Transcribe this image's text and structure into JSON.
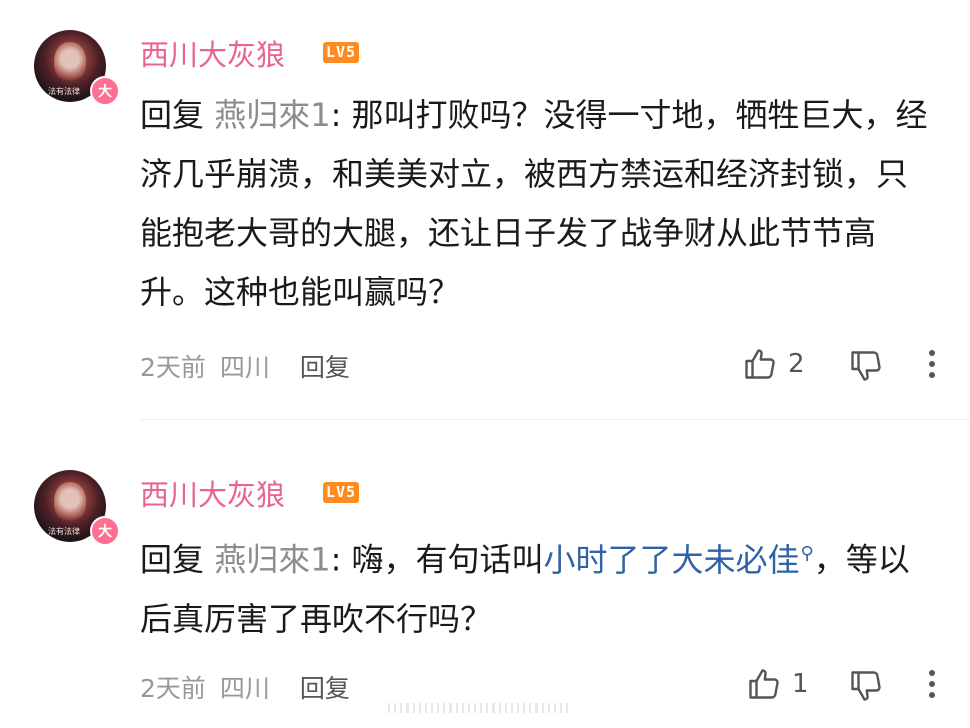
{
  "comments": [
    {
      "username": "西川大灰狼",
      "level": "LV5",
      "avatar_badge": "大",
      "avatar_caption": "法有法律",
      "reply_prefix": "回复",
      "reply_target": "燕归來1",
      "text": ": 那叫打败吗？没得一寸地，牺牲巨大，经济几乎崩溃，和美美对立，被西方禁运和经济封锁，只能抱老大哥的大腿，还让日子发了战争财从此节节高升。这种也能叫赢吗？",
      "time": "2天前",
      "location": "四川",
      "reply_action": "回复",
      "likes": "2"
    },
    {
      "username": "西川大灰狼",
      "level": "LV5",
      "avatar_badge": "大",
      "avatar_caption": "法有法律",
      "reply_prefix": "回复",
      "reply_target": "燕归來1",
      "text_before": ": 嗨，有句话叫",
      "link_text": "小时了了大未必佳",
      "text_after": "，等以后真厉害了再吹不行吗？",
      "time": "2天前",
      "location": "四川",
      "reply_action": "回复",
      "likes": "1"
    }
  ],
  "icons": {
    "like": "thumbs-up-icon",
    "dislike": "thumbs-down-icon",
    "more": "more-vertical-icon",
    "search": "search-icon"
  },
  "colors": {
    "username": "#e96591",
    "level_badge": "#ff8a1f",
    "link": "#2f62a8",
    "avatar_badge": "#ff6f8f"
  }
}
